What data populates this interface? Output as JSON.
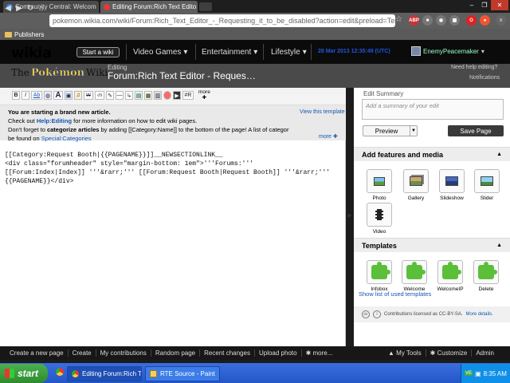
{
  "browser": {
    "tabs": [
      {
        "label": "Community Central: Welcom",
        "active": false
      },
      {
        "label": "Editing Forum:Rich Text Edito",
        "active": true
      }
    ],
    "url": "pokemon.wikia.com/wiki/Forum:Rich_Text_Editor_-_Requesting_it_to_be_disabled?action=edit&preload=Tem",
    "bookmark_folder": "Publishers"
  },
  "wikia_header": {
    "logo": "wikia",
    "start_wiki": "Start a wiki",
    "nav": [
      "Video Games",
      "Entertainment",
      "Lifestyle"
    ],
    "timestamp": "28 Mar 2013 12:35:49 (UTC)",
    "username": "EnemyPeacemaker"
  },
  "wiki_header": {
    "logo_pre": "The",
    "logo_main": "Pokémon",
    "logo_post": "Wiki",
    "editing_label": "Editing",
    "page_title": "Forum:Rich Text Editor - Reques…",
    "help_link": "Need help editing?",
    "notifications": "Notifications"
  },
  "toolbar": {
    "buttons": [
      "B",
      "I",
      "Ab",
      "Ω",
      "A",
      "—",
      "√n",
      "≡",
      "#R"
    ],
    "more": "more"
  },
  "notice": {
    "title": "You are starting a brand new article.",
    "line2_pre": "Check out ",
    "line2_link": "Help:Editing",
    "line2_post": " for more information on how to edit wiki pages.",
    "line3_pre": "Don't forget to ",
    "line3_bold": "categorize articles",
    "line3_post": " by adding [[Category:Name]] to the bottom of the page! A list of categor",
    "line4_pre": "be found on ",
    "line4_link": "Special:Categories",
    "view_template": "View this template",
    "more": "more"
  },
  "editor_text": "[[Category:Request Booth|{{PAGENAME}}]]__NEWSECTIONLINK__\n<div class=\"forumheader\" style=\"margin-bottom: 1em\">'''Forums:'''\n[[Forum:Index|Index]] '''&rarr;''' [[Forum:Request Booth|Request Booth]] '''&rarr;'''\n{{PAGENAME}}</div>",
  "right_rail": {
    "edit_summary_label": "Edit Summary",
    "summary_placeholder": "Add a summary of your edit",
    "preview": "Preview",
    "save": "Save Page",
    "features_title": "Add features and media",
    "media": [
      "Photo",
      "Gallery",
      "Slideshow",
      "Slider",
      "Video"
    ],
    "templates_title": "Templates",
    "templates": [
      "Infobox",
      "Welcome",
      "WelcomeIP",
      "Delete"
    ],
    "show_templates": "Show list of used templates",
    "license_text": "Contributions licensed as CC-BY-SA.",
    "license_link": "More details."
  },
  "bottom_bar": {
    "items": [
      "Create a new page",
      "Create",
      "My contributions",
      "Random page",
      "Recent changes",
      "Upload photo",
      "more..."
    ],
    "right": [
      "My Tools",
      "Customize",
      "Admin"
    ]
  },
  "taskbar": {
    "start": "start",
    "tasks": [
      "Editing Forum:Rich Te...",
      "RTE Source - Paint"
    ],
    "clock": "8:35 AM"
  },
  "colors": {
    "wikia_black": "#0b0b0b",
    "link_blue": "#1455b3",
    "save_button": "#3a3a3a",
    "xp_blue": "#2456c7",
    "template_green": "#5cbf3a"
  }
}
